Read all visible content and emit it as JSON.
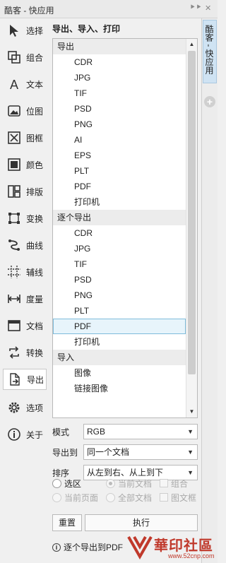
{
  "titlebar": {
    "title": "酷客 - 快应用",
    "pin": "⯈⯈",
    "close": "✕"
  },
  "tools": [
    {
      "label": "选择",
      "icon": "cursor-icon"
    },
    {
      "label": "组合",
      "icon": "group-icon"
    },
    {
      "label": "文本",
      "icon": "text-icon"
    },
    {
      "label": "位图",
      "icon": "bitmap-icon"
    },
    {
      "label": "图框",
      "icon": "frame-icon"
    },
    {
      "label": "颜色",
      "icon": "color-icon"
    },
    {
      "label": "排版",
      "icon": "layout-icon"
    },
    {
      "label": "变换",
      "icon": "transform-icon"
    },
    {
      "label": "曲线",
      "icon": "curve-icon"
    },
    {
      "label": "辅线",
      "icon": "guideline-icon"
    },
    {
      "label": "度量",
      "icon": "measure-icon"
    },
    {
      "label": "文档",
      "icon": "document-icon"
    },
    {
      "label": "转换",
      "icon": "convert-icon"
    },
    {
      "label": "导出",
      "icon": "export-icon"
    },
    {
      "label": "选项",
      "icon": "gear-icon"
    },
    {
      "label": "关于",
      "icon": "info-icon"
    }
  ],
  "main": {
    "heading": "导出、导入、打印",
    "list": [
      {
        "type": "group",
        "label": "导出"
      },
      {
        "type": "item",
        "label": "CDR"
      },
      {
        "type": "item",
        "label": "JPG"
      },
      {
        "type": "item",
        "label": "TIF"
      },
      {
        "type": "item",
        "label": "PSD"
      },
      {
        "type": "item",
        "label": "PNG"
      },
      {
        "type": "item",
        "label": "AI"
      },
      {
        "type": "item",
        "label": "EPS"
      },
      {
        "type": "item",
        "label": "PLT"
      },
      {
        "type": "item",
        "label": "PDF"
      },
      {
        "type": "item",
        "label": "打印机"
      },
      {
        "type": "group",
        "label": "逐个导出"
      },
      {
        "type": "item",
        "label": "CDR"
      },
      {
        "type": "item",
        "label": "JPG"
      },
      {
        "type": "item",
        "label": "TIF"
      },
      {
        "type": "item",
        "label": "PSD"
      },
      {
        "type": "item",
        "label": "PNG"
      },
      {
        "type": "item",
        "label": "PLT"
      },
      {
        "type": "item",
        "label": "PDF",
        "selected": true
      },
      {
        "type": "item",
        "label": "打印机"
      },
      {
        "type": "group",
        "label": "导入"
      },
      {
        "type": "item",
        "label": "图像"
      },
      {
        "type": "item",
        "label": "链接图像"
      }
    ],
    "mode": {
      "label": "模式",
      "value": "RGB"
    },
    "export_to": {
      "label": "导出到",
      "value": "同一个文档"
    },
    "sort": {
      "label": "排序",
      "value": "从左到右、从上到下"
    },
    "options": {
      "selection": "选区",
      "current_doc": "当前文档",
      "combine": "组合",
      "current_page": "当前页面",
      "all_docs": "全部文档",
      "frame": "图文框"
    },
    "reset_button": "重置",
    "run_button": "执行",
    "info_text": "逐个导出到PDF"
  },
  "right_tab": {
    "label": "酷客 - 快应用",
    "add": "+"
  },
  "watermark": {
    "text": "華印社區",
    "url": "www.52cnp.com"
  }
}
